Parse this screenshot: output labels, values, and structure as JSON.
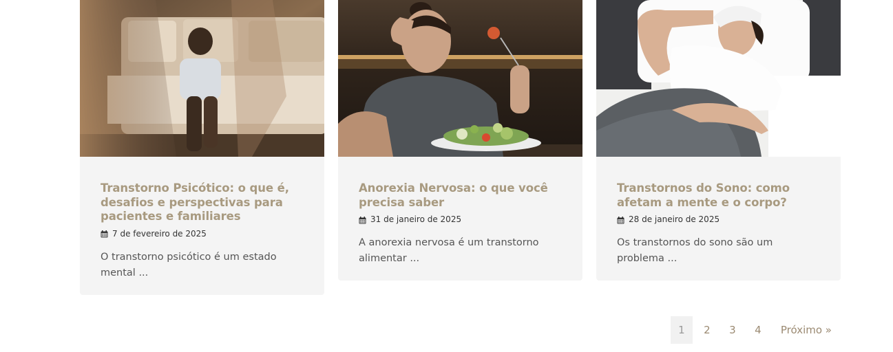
{
  "posts": [
    {
      "image_alt": "Criança sentada no chão ao lado do sofá com figura desfocada em movimento",
      "title": "Transtorno Psicótico: o que é, desafios e perspectivas para pacientes e familiares",
      "date": "7 de fevereiro de 2025",
      "excerpt": "O transtorno psicótico é um estado mental ..."
    },
    {
      "image_alt": "Mulher entediada segurando garfo diante de um prato de salada",
      "title": "Anorexia Nervosa: o que você precisa saber",
      "date": "31 de janeiro de 2025",
      "excerpt": "A anorexia nervosa é um transtorno alimentar ..."
    },
    {
      "image_alt": "Mulher deitada na cama com compressa na testa",
      "title": "Transtornos do Sono: como afetam a mente e o corpo?",
      "date": "28 de janeiro de 2025",
      "excerpt": "Os transtornos do sono são um problema ..."
    }
  ],
  "icons": {
    "date": "calendar-icon"
  },
  "colors": {
    "title": "#a89a80",
    "card_bg": "#f4f4f4",
    "link": "#9b8a72"
  },
  "pagination": {
    "pages": [
      "1",
      "2",
      "3",
      "4"
    ],
    "current": "1",
    "next": "Próximo »"
  }
}
